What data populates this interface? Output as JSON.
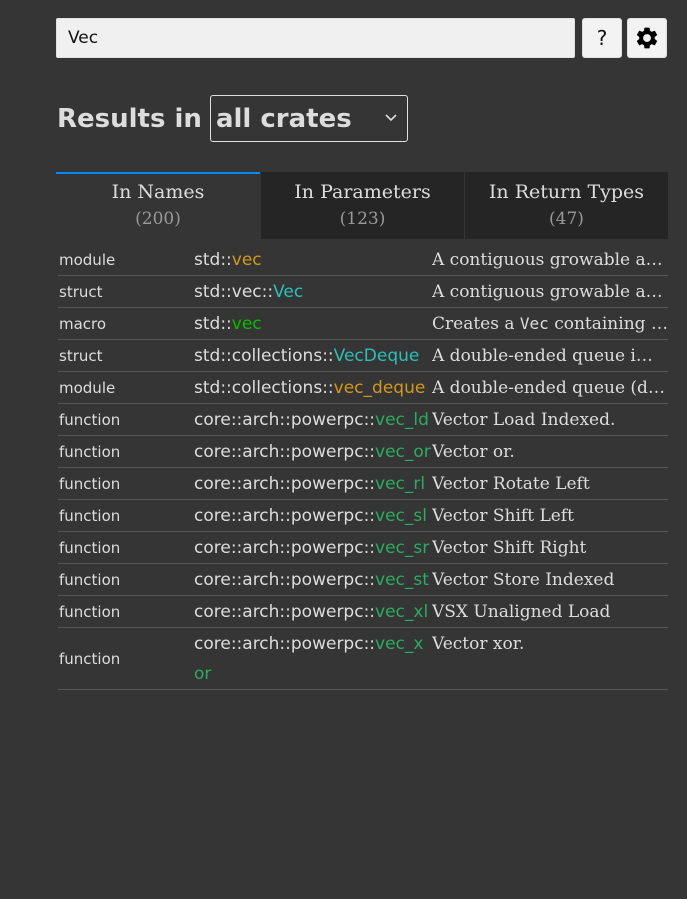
{
  "search": {
    "value": "Vec",
    "help_label": "?"
  },
  "results_header": {
    "title": "Results in",
    "crate_filter": "all crates"
  },
  "tabs": [
    {
      "label": "In Names",
      "count": "(200)",
      "active": true
    },
    {
      "label": "In Parameters",
      "count": "(123)",
      "active": false
    },
    {
      "label": "In Return Types",
      "count": "(47)",
      "active": false
    }
  ],
  "colors": {
    "module": "#d2991d",
    "struct": "#2dbfb8",
    "macro": "#09bd00",
    "function": "#2bab63",
    "tab_active_border": "#0089ff"
  },
  "results": [
    {
      "kind": "module",
      "path_prefix": "std::",
      "name": "vec",
      "name_type": "module",
      "desc": "A contiguous growable array type with heap-allocated contents, written Vec<T>."
    },
    {
      "kind": "struct",
      "path_prefix": "std::vec::",
      "name": "Vec",
      "name_type": "struct",
      "desc": "A contiguous growable array type, written as Vec<T>."
    },
    {
      "kind": "macro",
      "path_prefix": "std::",
      "name": "vec",
      "name_type": "macro",
      "desc_before": "Creates a ",
      "desc_code": "Vec",
      "desc_after": " containing the arguments."
    },
    {
      "kind": "struct",
      "path_prefix": "std::collections::",
      "name": "VecDeque",
      "name_type": "struct",
      "desc": "A double-ended queue implemented with a growable ring buffer."
    },
    {
      "kind": "module",
      "path_prefix": "std::collections::",
      "name": "vec_deque",
      "name_type": "module",
      "desc": "A double-ended queue (deque) implemented with a growable ring buffer."
    },
    {
      "kind": "function",
      "path_prefix": "core::arch::powerpc::",
      "name": "vec_ld",
      "name_type": "function",
      "desc": "Vector Load Indexed."
    },
    {
      "kind": "function",
      "path_prefix": "core::arch::powerpc::",
      "name": "vec_or",
      "name_type": "function",
      "desc": "Vector or."
    },
    {
      "kind": "function",
      "path_prefix": "core::arch::powerpc::",
      "name": "vec_rl",
      "name_type": "function",
      "desc": "Vector Rotate Left"
    },
    {
      "kind": "function",
      "path_prefix": "core::arch::powerpc::",
      "name": "vec_sl",
      "name_type": "function",
      "desc": "Vector Shift Left"
    },
    {
      "kind": "function",
      "path_prefix": "core::arch::powerpc::",
      "name": "vec_sr",
      "name_type": "function",
      "desc": "Vector Shift Right"
    },
    {
      "kind": "function",
      "path_prefix": "core::arch::powerpc::",
      "name": "vec_st",
      "name_type": "function",
      "desc": "Vector Store Indexed"
    },
    {
      "kind": "function",
      "path_prefix": "core::arch::powerpc::",
      "name": "vec_xl",
      "name_type": "function",
      "desc": "VSX Unaligned Load"
    },
    {
      "kind": "function",
      "path_prefix": "core::arch::powerpc::",
      "name": "vec_xor",
      "name_type": "function",
      "desc": "Vector xor."
    }
  ]
}
